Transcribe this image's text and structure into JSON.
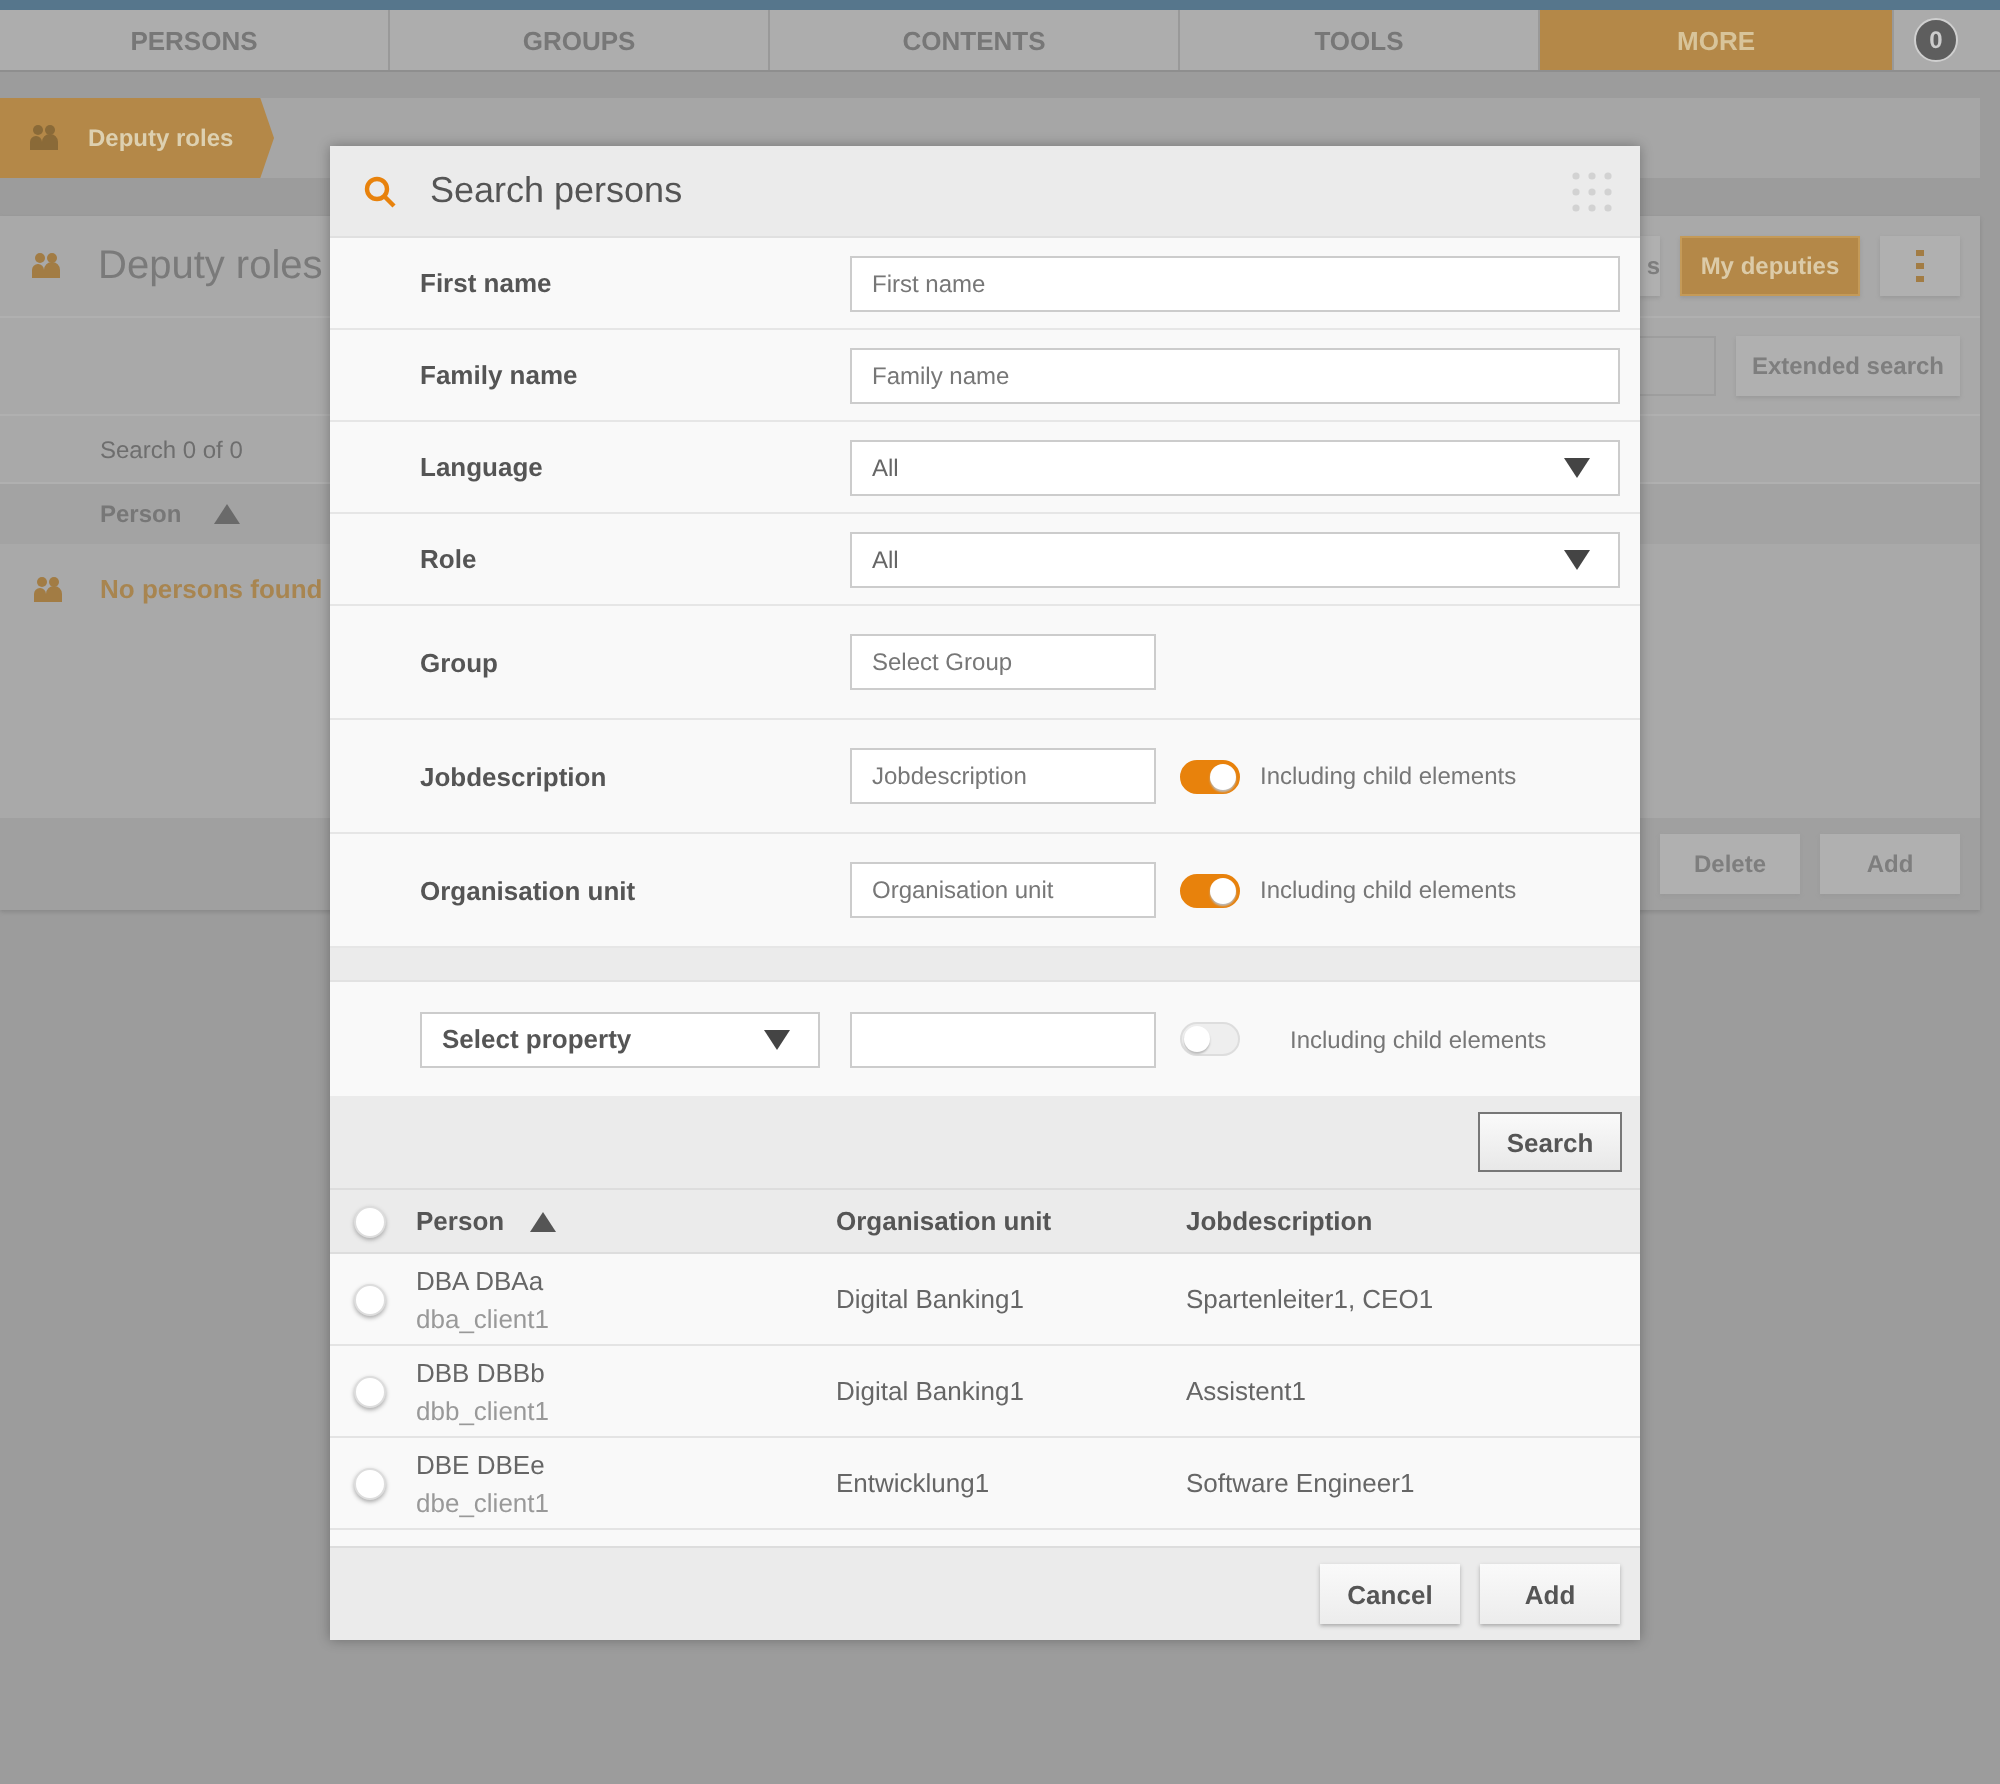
{
  "nav": {
    "tabs": [
      {
        "label": "PERSONS",
        "selected": false
      },
      {
        "label": "GROUPS",
        "selected": false
      },
      {
        "label": "CONTENTS",
        "selected": false
      },
      {
        "label": "TOOLS",
        "selected": false
      },
      {
        "label": "MORE",
        "selected": true
      }
    ],
    "badge": "0"
  },
  "breadcrumb": [
    {
      "label": "Deputy roles"
    }
  ],
  "page": {
    "title": "Deputy roles",
    "partial_button": "s",
    "my_deputies": {
      "label": "My deputies",
      "selected": true
    },
    "extended_search": "Extended search",
    "search_count": "Search 0 of 0",
    "column": {
      "label": "Person",
      "sorted": true
    },
    "empty": "No persons found",
    "buttons": [
      "Delete",
      "Add"
    ]
  },
  "dialog": {
    "title": "Search persons",
    "fields": [
      {
        "kind": "text",
        "label": "First name",
        "placeholder": "First name"
      },
      {
        "kind": "text",
        "label": "Family name",
        "placeholder": "Family name"
      },
      {
        "kind": "select",
        "label": "Language",
        "value": "All"
      },
      {
        "kind": "select",
        "label": "Role",
        "value": "All"
      },
      {
        "kind": "short",
        "label": "Group",
        "placeholder": "Select Group"
      },
      {
        "kind": "toggle",
        "label": "Jobdescription",
        "placeholder": "Jobdescription",
        "on": true,
        "toggle_label": "Including child elements"
      },
      {
        "kind": "toggle",
        "label": "Organisation unit",
        "placeholder": "Organisation unit",
        "on": true,
        "toggle_label": "Including child elements"
      }
    ],
    "property": {
      "value": "Select property",
      "on": false,
      "toggle_label": "Including child elements"
    },
    "search_button": "Search",
    "select_all": false,
    "columns": [
      {
        "label": "Person",
        "sorted": true
      },
      {
        "label": "Organisation unit",
        "sorted": false
      },
      {
        "label": "Jobdescription",
        "sorted": false
      }
    ],
    "rows": [
      {
        "name": "DBA DBAa",
        "login": "dba_client1",
        "org_unit": "Digital Banking1",
        "job": "Spartenleiter1, CEO1",
        "selected": false
      },
      {
        "name": "DBB DBBb",
        "login": "dbb_client1",
        "org_unit": "Digital Banking1",
        "job": "Assistent1",
        "selected": false
      },
      {
        "name": "DBE DBEe",
        "login": "dbe_client1",
        "org_unit": "Entwicklung1",
        "job": "Software Engineer1",
        "selected": false
      }
    ],
    "buttons": [
      "Cancel",
      "Add"
    ]
  }
}
